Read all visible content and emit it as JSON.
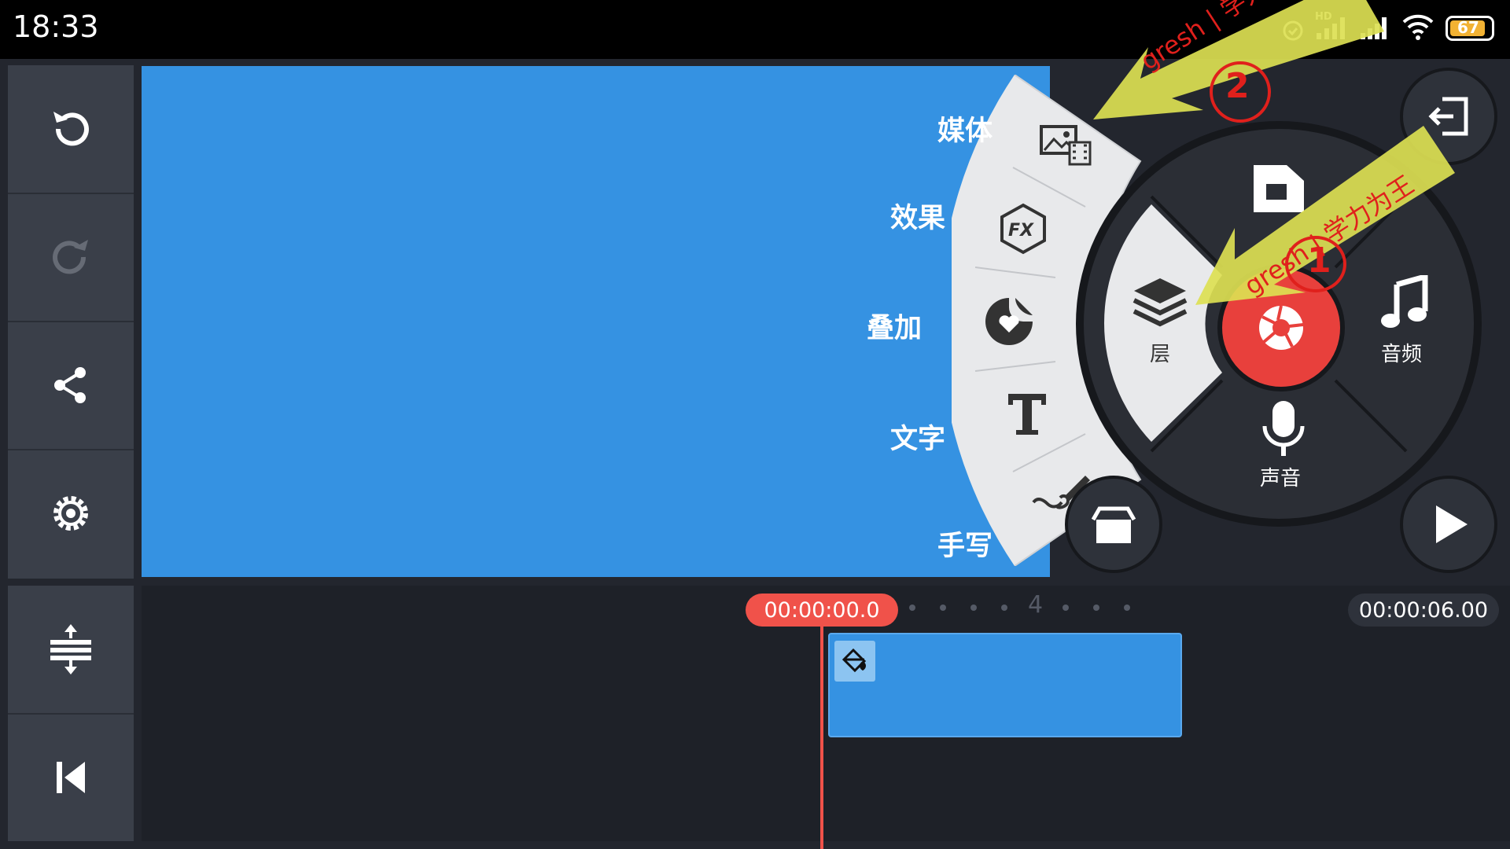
{
  "status_bar": {
    "time": "18:33",
    "network_badge": "HD",
    "battery": "67",
    "icons": [
      "alarm-icon",
      "signal-hd-icon",
      "signal-icon",
      "wifi-icon",
      "battery-icon"
    ]
  },
  "sidebar": {
    "items": [
      {
        "name": "undo",
        "icon": "undo-icon"
      },
      {
        "name": "redo",
        "icon": "redo-icon"
      },
      {
        "name": "share",
        "icon": "share-icon"
      },
      {
        "name": "settings",
        "icon": "gear-icon"
      }
    ],
    "bottom_items": [
      {
        "name": "expand-timeline",
        "icon": "expand-vertical-icon"
      },
      {
        "name": "go-to-start",
        "icon": "skip-to-start-icon"
      }
    ]
  },
  "media_menu": {
    "items": [
      {
        "label": "媒体",
        "icon": "image-film-icon"
      },
      {
        "label": "效果",
        "icon": "fx-hexagon-icon"
      },
      {
        "label": "叠加",
        "icon": "heart-sticker-icon"
      },
      {
        "label": "文字",
        "icon": "text-t-icon"
      },
      {
        "label": "手写",
        "icon": "brush-icon"
      }
    ]
  },
  "wheel": {
    "layer_label": "层",
    "audio_label": "音频",
    "voice_label": "声音",
    "center_icon": "camera-shutter-icon",
    "top_icon": "folder-media-icon"
  },
  "annotations": {
    "arrow1_text": "gresh | 学力为王",
    "arrow1_number": "1",
    "arrow2_text": "gresh | 学力为",
    "arrow2_number": "2"
  },
  "timeline": {
    "current_time": "00:00:00.0",
    "duration": "00:00:06.00",
    "tick_label": "4",
    "clip_icon": "paint-bucket-icon"
  },
  "colors": {
    "accent": "#f0524a",
    "preview_blue": "#3592e2",
    "panel": "#3a3f49",
    "annotation_yellow": "#dce052",
    "annotation_red": "#e0201c"
  }
}
